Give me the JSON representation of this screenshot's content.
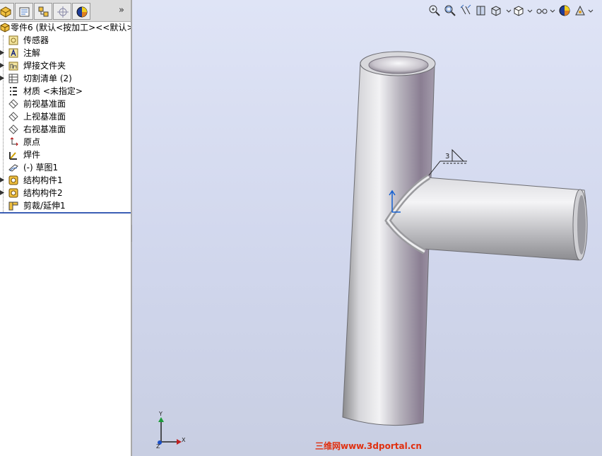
{
  "panel": {
    "more_glyph": "»",
    "tabs": [
      {
        "name": "feature-manager-tab",
        "icon": "parts-icon"
      },
      {
        "name": "property-manager-tab",
        "icon": "property-icon"
      },
      {
        "name": "configuration-manager-tab",
        "icon": "configuration-icon"
      },
      {
        "name": "dimxpert-tab",
        "icon": "crosshair-icon"
      },
      {
        "name": "display-manager-tab",
        "icon": "display-pie-icon"
      }
    ]
  },
  "tree": {
    "root_label": "零件6 (默认<按加工><<默认>_",
    "items": [
      {
        "label": "传感器",
        "icon": "sensor-icon",
        "expandable": false
      },
      {
        "label": "注解",
        "icon": "annotation-icon",
        "expandable": true
      },
      {
        "label": "焊接文件夹",
        "icon": "weldment-folder-icon",
        "expandable": true
      },
      {
        "label": "切割清单 (2)",
        "icon": "cut-list-icon",
        "expandable": true
      },
      {
        "label": "材质 <未指定>",
        "icon": "material-icon",
        "expandable": false
      },
      {
        "label": "前视基准面",
        "icon": "plane-icon",
        "expandable": false
      },
      {
        "label": "上视基准面",
        "icon": "plane-icon",
        "expandable": false
      },
      {
        "label": "右视基准面",
        "icon": "plane-icon",
        "expandable": false
      },
      {
        "label": "原点",
        "icon": "origin-icon",
        "expandable": false
      },
      {
        "label": "焊件",
        "icon": "weldment-icon",
        "expandable": false
      },
      {
        "label": "(-) 草图1",
        "icon": "sketch-icon",
        "expandable": false
      },
      {
        "label": "结构构件1",
        "icon": "structural-member-icon",
        "expandable": true
      },
      {
        "label": "结构构件2",
        "icon": "structural-member-icon",
        "expandable": true
      },
      {
        "label": "剪裁/延伸1",
        "icon": "trim-extend-icon",
        "expandable": false
      }
    ]
  },
  "view_toolbar": [
    {
      "name": "zoom-to-fit-icon"
    },
    {
      "name": "zoom-to-area-icon"
    },
    {
      "name": "previous-view-icon"
    },
    {
      "name": "section-view-icon"
    },
    {
      "name": "view-orientation-icon"
    },
    {
      "name": "display-style-icon"
    },
    {
      "name": "hide-show-icon"
    },
    {
      "name": "edit-appearance-icon"
    },
    {
      "name": "apply-scene-icon"
    }
  ],
  "viewport": {
    "weld_symbol_value": "3",
    "triad": {
      "x": "X",
      "y": "Y",
      "z": "Z"
    }
  },
  "watermark": "三维网www.3dportal.cn",
  "colors": {
    "tree_end_line": "#3c5fb5",
    "viewport_top": "#dfe4f6",
    "viewport_bottom": "#c8cee2",
    "watermark": "#e03010"
  }
}
